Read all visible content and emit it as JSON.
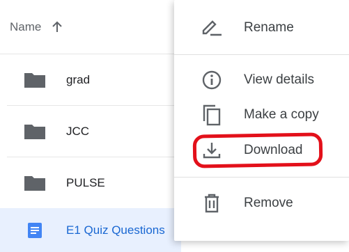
{
  "list": {
    "header": {
      "name_label": "Name",
      "sort_icon": "arrow-up-icon"
    },
    "rows": [
      {
        "label": "grad",
        "icon": "folder-icon"
      },
      {
        "label": "JCC",
        "icon": "folder-icon"
      },
      {
        "label": "PULSE",
        "icon": "folder-icon"
      },
      {
        "label": "E1 Quiz Questions",
        "icon": "google-doc-icon"
      }
    ]
  },
  "menu": {
    "rename": "Rename",
    "view_details": "View details",
    "make_copy": "Make a copy",
    "download": "Download",
    "remove": "Remove"
  },
  "colors": {
    "folder": "#5f6368",
    "doc": "#4285f4",
    "selected_bg": "#e8f0fe",
    "annotation": "#e3101a"
  }
}
